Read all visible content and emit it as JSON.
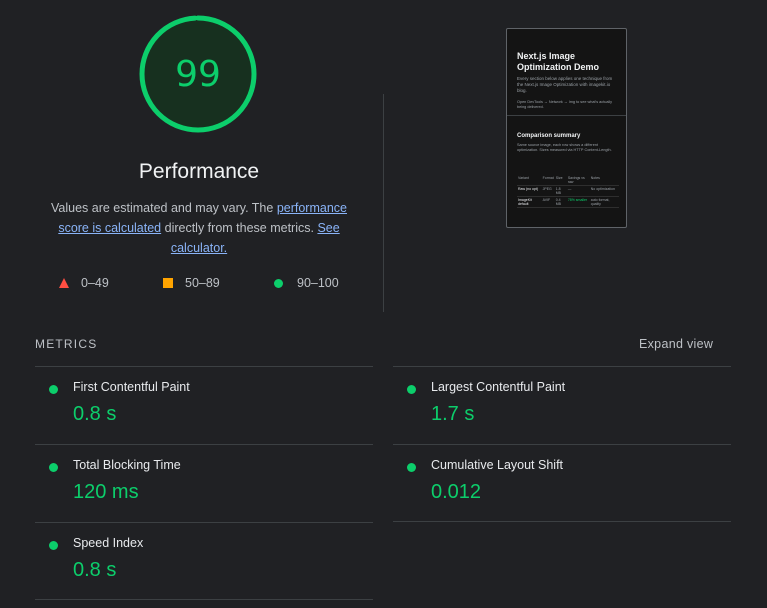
{
  "score": {
    "value": "99",
    "fraction": 0.99,
    "color": "#0cce6b"
  },
  "performance": {
    "title": "Performance",
    "desc_pre": "Values are estimated and may vary. The ",
    "link1": "performance score is calculated",
    "desc_mid": " directly from these metrics. ",
    "link2": "See calculator."
  },
  "legend": [
    {
      "range": "0–49",
      "shape": "triangle",
      "color": "#ff4e42"
    },
    {
      "range": "50–89",
      "shape": "square",
      "color": "#ffa400"
    },
    {
      "range": "90–100",
      "shape": "circle",
      "color": "#0cce6b"
    }
  ],
  "thumbnail": {
    "title": "Next.js Image Optimization Demo",
    "subtitle": "Every section below applies one technique from the Next.js Image Optimization with imagekit.io blog.",
    "hint": "Open DevTools → Network → Img to see what's actually being delivered.",
    "section_title": "Comparison summary",
    "section_text": "Same source image, each row shows a different optimization. Sizes measured via HTTP Content-Length.",
    "table_head": [
      "Variant",
      "Format",
      "Size",
      "Savings vs raw",
      "Notes"
    ],
    "rows": [
      [
        "Raw (no opt)",
        "JPEG",
        "1.8 MB",
        "—",
        "No optimization"
      ],
      [
        "ImageKit default",
        "AVIF",
        "0.4 MB",
        "78% smaller",
        "auto format, quality"
      ]
    ]
  },
  "metrics_section": {
    "label": "METRICS",
    "expand": "Expand view",
    "items": [
      {
        "name": "First Contentful Paint",
        "value": "0.8 s"
      },
      {
        "name": "Largest Contentful Paint",
        "value": "1.7 s"
      },
      {
        "name": "Total Blocking Time",
        "value": "120 ms"
      },
      {
        "name": "Cumulative Layout Shift",
        "value": "0.012"
      },
      {
        "name": "Speed Index",
        "value": "0.8 s"
      }
    ]
  }
}
